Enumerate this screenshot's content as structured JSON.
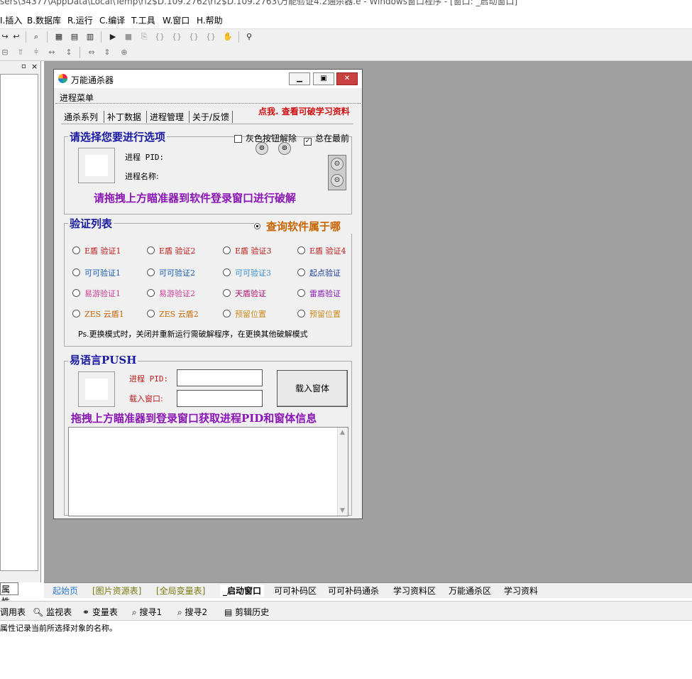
{
  "window_title": "sers\\34377\\AppData\\Local\\Temp\\ri2$D.109.2762\\ri2$D.109.2763\\万能验证4.2通杀器.e - Windows窗口程序 - [窗口: _启动窗口]",
  "menu": [
    "I.插入",
    "B.数据库",
    "R.运行",
    "C.编译",
    "T.工具",
    "W.窗口",
    "H.帮助"
  ],
  "left_panel": {
    "tab_label": "属性",
    "pin": "▫",
    "close": "×"
  },
  "dialog": {
    "title": "万能通杀器",
    "menu_label": "进程菜单",
    "tabs": [
      "通杀系列",
      "补丁数据",
      "进程管理",
      "关于/反馈"
    ],
    "link_text": "点我. 查看可破学习资料",
    "group1": {
      "title": "请选择您要进行选项",
      "gray_btn_check": "灰色按钮解除",
      "topmost_check": "总在最前",
      "pid_label": "进程 PID:",
      "name_label": "进程名称:",
      "hint": "请拖拽上方瞄准器到软件登录窗口进行破解"
    },
    "group2": {
      "title": "验证列表",
      "query_radio": "查询软件属于哪",
      "options": [
        [
          "E盾 验证1",
          "E盾 验证2",
          "E盾 验证3",
          "E盾 验证4"
        ],
        [
          "可可验证1",
          "可可验证2",
          "可可验证3",
          "起点验证"
        ],
        [
          "易游验证1",
          "易游验证2",
          "天盾验证",
          "雷盾验证"
        ],
        [
          "ZES 云盾1",
          "ZES 云盾2",
          "预留位置",
          "预留位置"
        ]
      ],
      "note": "Ps.更换模式时，关闭并重新运行需破解程序，在更换其他破解模式"
    },
    "group3": {
      "title": "易语言PUSH",
      "pid_label": "进程 PID:",
      "load_label": "载入窗口:",
      "load_button": "载入窗体",
      "pid_value": "",
      "load_value": "",
      "hint": "拖拽上方瞄准器到登录窗口获取进程PID和窗体信息"
    }
  },
  "tabs_bottom": [
    "起始页",
    "[图片资源表]",
    "[全局变量表]",
    "_启动窗口",
    "可可补码区",
    "可可补码通杀",
    "学习资料区",
    "万能通杀区",
    "学习资料"
  ],
  "bottom_toolbar": [
    "调用表",
    "监视表",
    "变量表",
    "搜寻1",
    "搜寻2",
    "剪辑历史"
  ],
  "status_text": "属性记录当前所选择对象的名称。",
  "colors": {
    "e_shield": "#c01818",
    "keke": "#1a5fb4",
    "yiyou": "#d0409a",
    "zes": "#c86400",
    "purple": "#8a16b5",
    "blue_title": "#1a1aa0"
  }
}
